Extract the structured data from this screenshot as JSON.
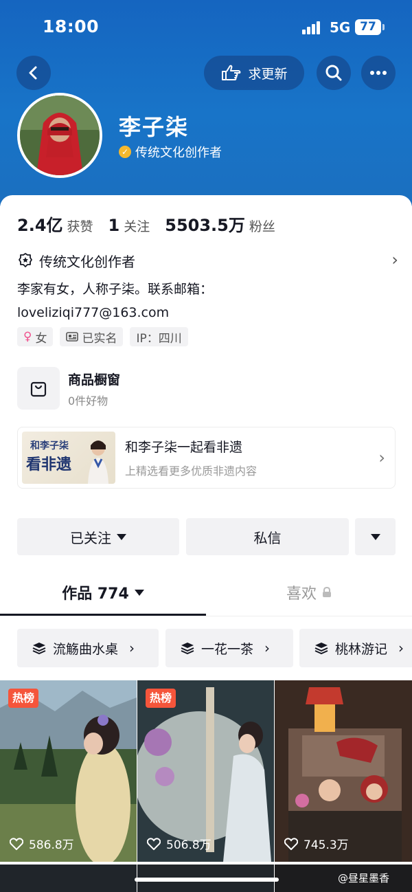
{
  "status": {
    "time": "18:00",
    "network": "5G",
    "battery": "77"
  },
  "header": {
    "update_label": "求更新",
    "name": "李子柒",
    "verified_title": "传统文化创作者"
  },
  "stats": [
    {
      "value": "2.4亿",
      "label": "获赞"
    },
    {
      "value": "1",
      "label": "关注"
    },
    {
      "value": "5503.5万",
      "label": "粉丝"
    }
  ],
  "certification": "传统文化创作者",
  "bio_line1": "李家有女，人称子柒。联系邮箱：",
  "bio_line2": "loveliziqi777@163.com",
  "tags": {
    "gender": "女",
    "real_name": "已实名",
    "ip": "IP：四川"
  },
  "shop": {
    "title": "商品橱窗",
    "subtitle": "0件好物"
  },
  "promo": {
    "thumb_text_small": "和李子柒",
    "thumb_text_big": "看非遗",
    "title": "和李子柒一起看非遗",
    "subtitle": "上精选看更多优质非遗内容"
  },
  "actions": {
    "follow": "已关注",
    "message": "私信"
  },
  "tabs": {
    "works": "作品 774",
    "likes": "喜欢"
  },
  "collections": [
    "流觞曲水桌",
    "一花一茶",
    "桃林游记"
  ],
  "videos": [
    {
      "hot": "热榜",
      "likes": "586.8万"
    },
    {
      "hot": "热榜",
      "likes": "506.8万"
    },
    {
      "hot": "",
      "likes": "745.3万"
    }
  ],
  "watermark": "@昼星墨香",
  "colors": {
    "header": "#1565c0",
    "hot_badge": "#f5553b",
    "verify_badge": "#f5b82e"
  }
}
